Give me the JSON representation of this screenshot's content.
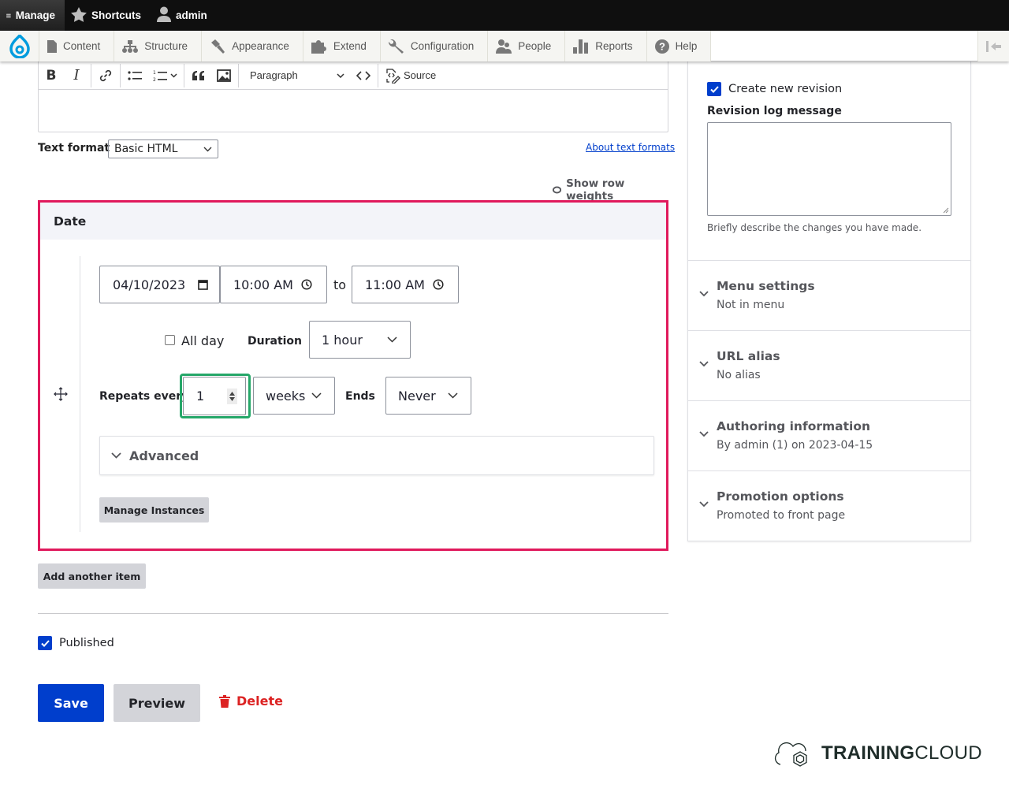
{
  "admin_toolbar": {
    "manage": "Manage",
    "shortcuts": "Shortcuts",
    "user": "admin"
  },
  "admin_menu": {
    "items": [
      {
        "label": "Content",
        "icon": "file-icon"
      },
      {
        "label": "Structure",
        "icon": "sitemap-icon"
      },
      {
        "label": "Appearance",
        "icon": "brush-icon"
      },
      {
        "label": "Extend",
        "icon": "puzzle-icon"
      },
      {
        "label": "Configuration",
        "icon": "wrench-icon"
      },
      {
        "label": "People",
        "icon": "people-icon"
      },
      {
        "label": "Reports",
        "icon": "bar-chart-icon"
      },
      {
        "label": "Help",
        "icon": "help-icon"
      }
    ]
  },
  "editor": {
    "block_format": "Paragraph",
    "source_label": "Source",
    "text_format_label": "Text format",
    "text_format_value": "Basic HTML",
    "about_text_formats": "About text formats"
  },
  "row_weights": "Show row weights",
  "date_field": {
    "title": "Date",
    "start_date": "04/10/2023",
    "start_time": "10:00 AM",
    "to_label": "to",
    "end_time": "11:00 AM",
    "all_day_label": "All day",
    "all_day_checked": false,
    "duration_label": "Duration",
    "duration_value": "1 hour",
    "repeats_every_label": "Repeats every",
    "repeat_interval": "1",
    "repeat_unit": "weeks",
    "ends_label": "Ends",
    "ends_value": "Never",
    "advanced_label": "Advanced",
    "manage_instances": "Manage Instances"
  },
  "add_another_item": "Add another item",
  "published_label": "Published",
  "published_checked": true,
  "actions": {
    "save": "Save",
    "preview": "Preview",
    "delete": "Delete"
  },
  "sidebar": {
    "create_revision_label": "Create new revision",
    "create_revision_checked": true,
    "revision_log_label": "Revision log message",
    "revision_log_value": "",
    "revision_log_help": "Briefly describe the changes you have made.",
    "sections": [
      {
        "title": "Menu settings",
        "summary": "Not in menu"
      },
      {
        "title": "URL alias",
        "summary": "No alias"
      },
      {
        "title": "Authoring information",
        "summary": "By admin (1) on 2023-04-15"
      },
      {
        "title": "Promotion options",
        "summary": "Promoted to front page"
      }
    ]
  },
  "branding": {
    "bold": "TRAINING",
    "light": "CLOUD"
  },
  "colors": {
    "primary_blue": "#003ecc",
    "highlight_border": "#e0195c",
    "focus_green": "#26a769",
    "danger_red": "#dc2323"
  }
}
